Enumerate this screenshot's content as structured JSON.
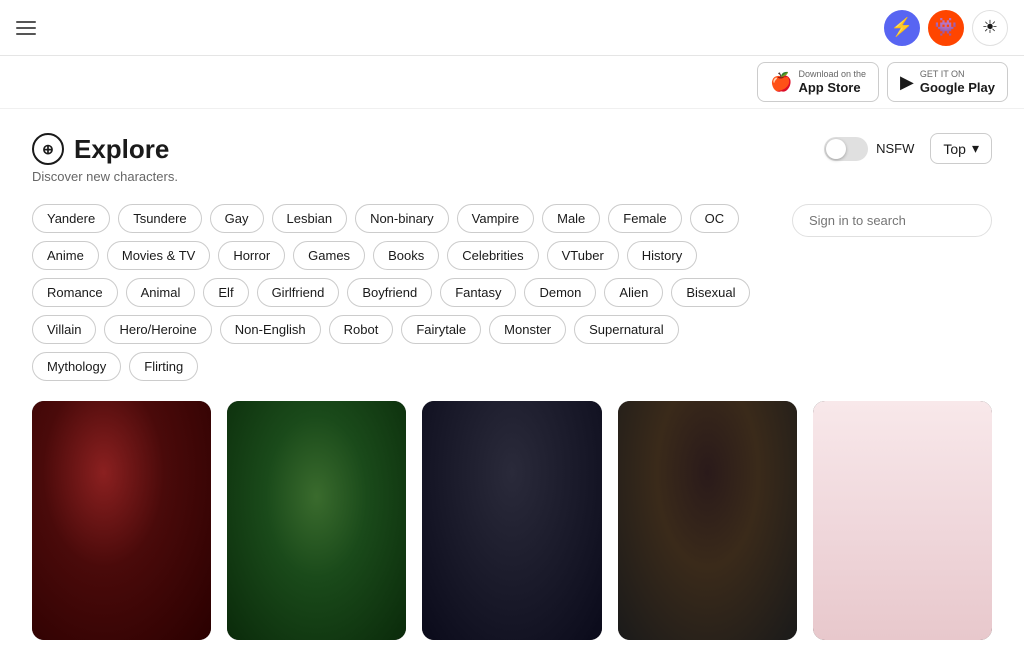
{
  "header": {
    "hamburger_label": "menu",
    "discord_icon": "💬",
    "reddit_icon": "🔴",
    "theme_icon": "☀"
  },
  "store_bar": {
    "app_store": {
      "label": "Download on the",
      "name": "App Store",
      "icon": "🍎"
    },
    "google_play": {
      "label": "GET IT ON",
      "name": "Google Play",
      "icon": "▶"
    }
  },
  "explore": {
    "title": "Explore",
    "subtitle": "Discover new characters.",
    "nsfw_label": "NSFW",
    "sort_label": "Top",
    "sort_chevron": "▾"
  },
  "search": {
    "placeholder": "Sign in to search"
  },
  "tags": {
    "row1": [
      "Yandere",
      "Tsundere",
      "Gay",
      "Lesbian",
      "Non-binary",
      "Vampire",
      "Male",
      "Female",
      "OC"
    ],
    "row2": [
      "Anime",
      "Movies & TV",
      "Horror",
      "Games",
      "Books",
      "Celebrities",
      "VTuber",
      "History"
    ],
    "row3": [
      "Romance",
      "Animal",
      "Elf",
      "Girlfriend",
      "Boyfriend",
      "Fantasy",
      "Demon",
      "Alien",
      "Bisexual"
    ],
    "row4": [
      "Villain",
      "Hero/Heroine",
      "Non-English",
      "Robot",
      "Fairytale",
      "Monster",
      "Supernatural"
    ],
    "row5": [
      "Mythology",
      "Flirting"
    ]
  },
  "cards": [
    {
      "id": 1,
      "theme": "fig-1"
    },
    {
      "id": 2,
      "theme": "fig-2"
    },
    {
      "id": 3,
      "theme": "fig-3"
    },
    {
      "id": 4,
      "theme": "fig-4"
    },
    {
      "id": 5,
      "theme": "fig-5"
    }
  ]
}
